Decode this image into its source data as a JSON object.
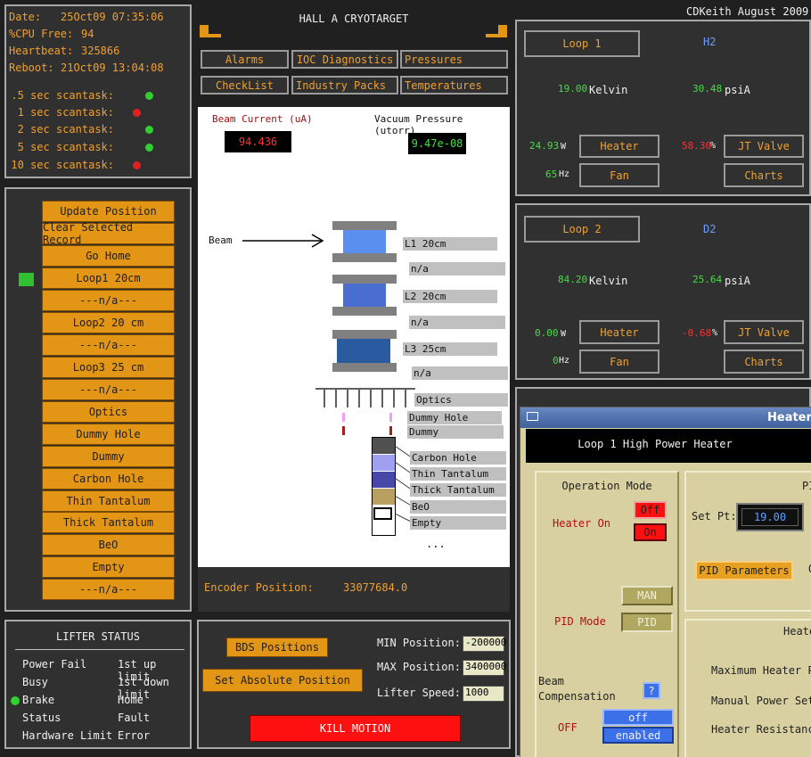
{
  "status": {
    "date_label": "Date:",
    "date_value": "25Oct09 07:35:06",
    "cpu_label": "%CPU Free:",
    "cpu_value": "94",
    "heartbeat_label": "Heartbeat:",
    "heartbeat_value": "325866",
    "reboot_label": "Reboot:",
    "reboot_value": "21Oct09 13:04:08",
    "scantasks": [
      {
        "label": ".5 sec scantask:",
        "color": "#30d030"
      },
      {
        "label": "1 sec scantask:",
        "color": "#e02020"
      },
      {
        "label": "2 sec scantask:",
        "color": "#30d030"
      },
      {
        "label": "5 sec scantask:",
        "color": "#30d030"
      },
      {
        "label": "10 sec scantask:",
        "color": "#e02020"
      }
    ]
  },
  "header": {
    "title": "HALL A CRYOTARGET",
    "credit": "CDKeith August 2009",
    "nav": [
      "Alarms",
      "IOC Diagnostics",
      "Pressures",
      "CheckList",
      "Industry Packs",
      "Temperatures"
    ]
  },
  "position_buttons": [
    "Update Position",
    "Clear Selected Record",
    "Go Home",
    "Loop1 20cm",
    "---n/a---",
    "Loop2 20 cm",
    "---n/a---",
    "Loop3 25 cm",
    "---n/a---",
    "Optics",
    "Dummy Hole",
    "Dummy",
    "Carbon Hole",
    "Thin Tantalum",
    "Thick Tantalum",
    "BeO",
    "Empty",
    "---n/a---"
  ],
  "diagram": {
    "beam_current_label": "Beam Current (uA)",
    "beam_current_value": "94.436",
    "vacuum_label": "Vacuum Pressure (utorr)",
    "vacuum_value": "9.47e-08",
    "beam_label": "Beam",
    "targets": [
      "L1 20cm",
      "n/a",
      "L2 20cm",
      "n/a",
      "L3 25cm",
      "n/a",
      "Optics",
      "Dummy Hole",
      "Dummy",
      "Carbon Hole",
      "Thin Tantalum",
      "Thick Tantalum",
      "BeO",
      "Empty",
      "..."
    ],
    "encoder_label": "Encoder Position:",
    "encoder_value": "33077684.0"
  },
  "lifter": {
    "title": "LIFTER STATUS",
    "left": [
      "Power Fail",
      "Busy",
      "Brake",
      "Status",
      "Hardware Limit"
    ],
    "right": [
      "1st up limit",
      "1st down limit",
      "Home",
      "Fault",
      "Error"
    ]
  },
  "motion": {
    "bds_button": "BDS Positions",
    "set_abs_button": "Set Absolute Position",
    "kill_button": "KILL MOTION",
    "min_label": "MIN Position:",
    "min_value": "-200000",
    "max_label": "MAX Position:",
    "max_value": "3400000",
    "speed_label": "Lifter Speed:",
    "speed_value": "1000"
  },
  "loop1": {
    "button": "Loop 1",
    "gas": "H2",
    "temp_value": "19.00",
    "temp_unit": "Kelvin",
    "pressure_value": "30.48",
    "pressure_unit": "psiA",
    "heater_value": "24.93",
    "heater_unit": "W",
    "heater_button": "Heater",
    "jt_value": "58.30",
    "jt_unit": "%",
    "jt_button": "JT Valve",
    "fan_value": "65",
    "fan_unit": "Hz",
    "fan_button": "Fan",
    "charts_button": "Charts"
  },
  "loop2": {
    "button": "Loop 2",
    "gas": "D2",
    "temp_value": "84.20",
    "temp_unit": "Kelvin",
    "pressure_value": "25.64",
    "pressure_unit": "psiA",
    "heater_value": "0.00",
    "heater_unit": "W",
    "heater_button": "Heater",
    "jt_value": "-0.68",
    "jt_unit": "%",
    "jt_button": "JT Valve",
    "fan_value": "0",
    "fan_unit": "Hz",
    "fan_button": "Fan",
    "charts_button": "Charts"
  },
  "heater_window": {
    "title": "Heater",
    "banner": "Loop 1 High Power Heater",
    "operation_mode": "Operation Mode",
    "heater_on_label": "Heater On",
    "off_button": "Off",
    "on_button": "On",
    "man_button": "MAN",
    "pid_button": "PID",
    "pid_mode_label": "PID Mode",
    "beam_comp_label_1": "Beam",
    "beam_comp_label_2": "Compensation",
    "help_button": "?",
    "comp_state": "OFF",
    "comp_off": "off",
    "comp_enabled": "enabled",
    "pi_label": "PI",
    "setpt_label": "Set Pt:",
    "setpt_value": "19.00",
    "pid_params_button": "PID Parameters",
    "o_label": "O",
    "heater_section": "Heater",
    "max_power_label": "Maximum Heater Powe",
    "manual_power_label": "Manual Power Settir",
    "resistance_label": "Heater Resistance:"
  }
}
